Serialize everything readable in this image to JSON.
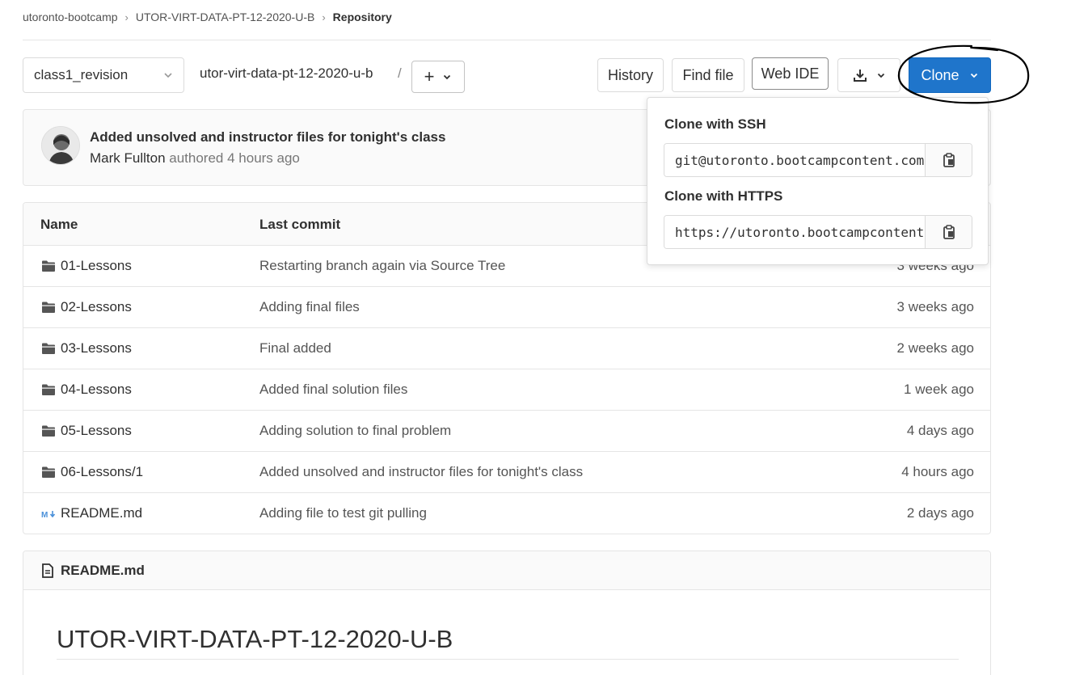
{
  "breadcrumb": {
    "items": [
      "utoronto-bootcamp",
      "UTOR-VIRT-DATA-PT-12-2020-U-B",
      "Repository"
    ]
  },
  "toolbar": {
    "branch": "class1_revision",
    "repo_path": "utor-virt-data-pt-12-2020-u-b",
    "path_separator": "/",
    "add_label": "+",
    "history_label": "History",
    "find_file_label": "Find file",
    "web_ide_label": "Web IDE",
    "clone_label": "Clone"
  },
  "last_commit": {
    "title": "Added unsolved and instructor files for tonight's class",
    "author": "Mark Fullton",
    "authored_text": "authored 4 hours ago"
  },
  "file_table": {
    "headers": [
      "Name",
      "Last commit"
    ],
    "rows": [
      {
        "name": "01-Lessons",
        "type": "folder",
        "commit": "Restarting branch again via Source Tree",
        "age": "3 weeks ago"
      },
      {
        "name": "02-Lessons",
        "type": "folder",
        "commit": "Adding final files",
        "age": "3 weeks ago"
      },
      {
        "name": "03-Lessons",
        "type": "folder",
        "commit": "Final added",
        "age": "2 weeks ago"
      },
      {
        "name": "04-Lessons",
        "type": "folder",
        "commit": "Added final solution files",
        "age": "1 week ago"
      },
      {
        "name": "05-Lessons",
        "type": "folder",
        "commit": "Adding solution to final problem",
        "age": "4 days ago"
      },
      {
        "name": "06-Lessons/1",
        "type": "folder",
        "commit": "Added unsolved and instructor files for tonight's class",
        "age": "4 hours ago"
      },
      {
        "name": "README.md",
        "type": "markdown",
        "commit": "Adding file to test git pulling",
        "age": "2 days ago"
      }
    ]
  },
  "readme": {
    "filename": "README.md",
    "heading": "UTOR-VIRT-DATA-PT-12-2020-U-B"
  },
  "clone_dropdown": {
    "ssh_label": "Clone with SSH",
    "ssh_url": "git@utoronto.bootcampcontent.com",
    "https_label": "Clone with HTTPS",
    "https_url": "https://utoronto.bootcampcontent.com"
  },
  "colors": {
    "clone_button": "#1f75cb",
    "annotation_stroke": "#000000"
  }
}
